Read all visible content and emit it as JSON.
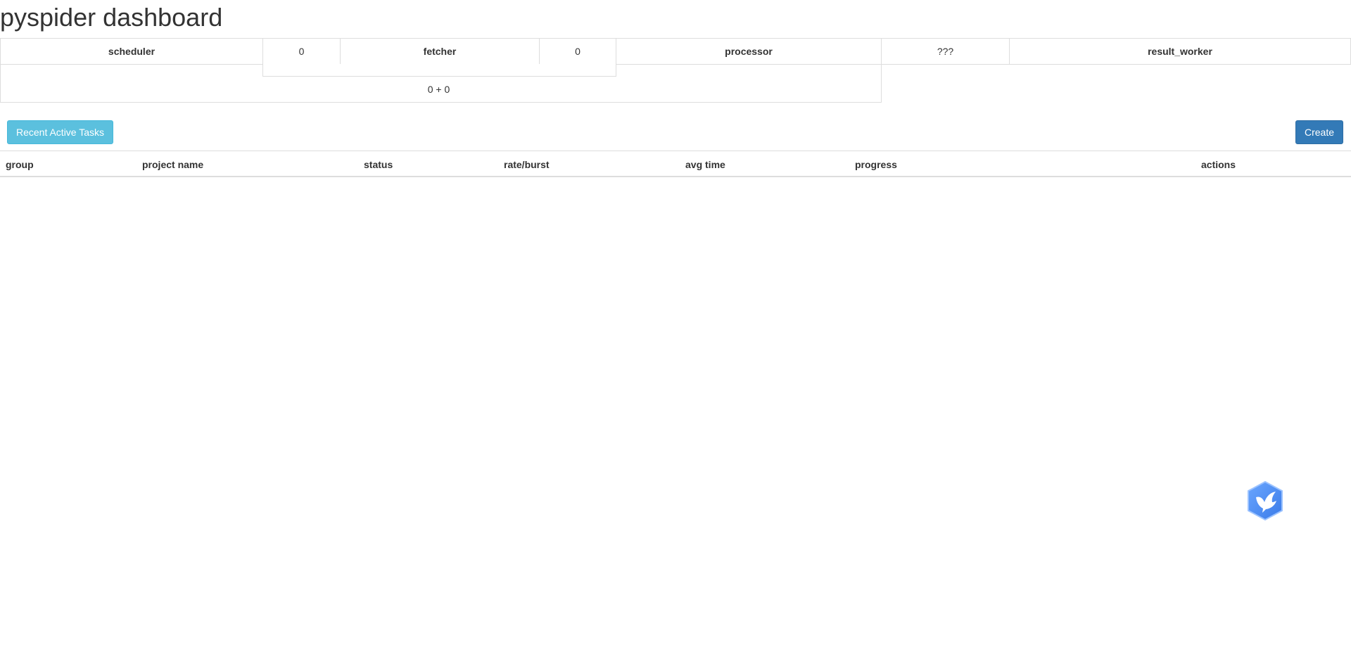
{
  "page": {
    "title": "pyspider dashboard"
  },
  "queue": {
    "scheduler_label": "scheduler",
    "scheduler_to_fetcher": "0",
    "fetcher_label": "fetcher",
    "fetcher_to_processor": "0",
    "processor_label": "processor",
    "processor_to_result": "???",
    "result_worker_label": "result_worker",
    "new_tasks": "0 + 0"
  },
  "toolbar": {
    "recent_active_tasks_label": "Recent Active Tasks",
    "create_label": "Create"
  },
  "projects_table": {
    "columns": [
      "group",
      "project name",
      "status",
      "rate/burst",
      "avg time",
      "progress",
      "actions"
    ],
    "rows": []
  },
  "floating_badge": {
    "icon": "bird-logo-icon",
    "color": "#4a8cf0"
  },
  "colors": {
    "info": "#5bc0de",
    "primary": "#337ab7",
    "border": "#dddddd"
  }
}
